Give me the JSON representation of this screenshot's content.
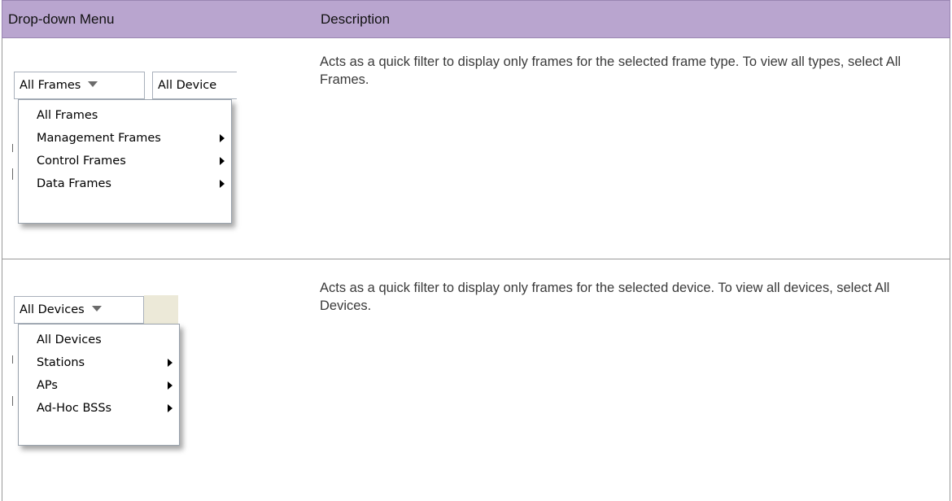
{
  "table": {
    "headers": [
      "Drop-down Menu",
      "Description"
    ],
    "rows": [
      {
        "description": "Acts as a quick filter to display only frames for the selected frame type. To view all types, select All Frames.",
        "widget": {
          "combo_label": "All Frames",
          "second_combo_label": "All Device",
          "menu_items": [
            {
              "label": "All Frames",
              "submenu": false
            },
            {
              "label": "Management Frames",
              "submenu": true
            },
            {
              "label": "Control Frames",
              "submenu": true
            },
            {
              "label": "Data Frames",
              "submenu": true
            }
          ]
        }
      },
      {
        "description": "Acts as a quick filter to display only frames for the selected device. To view all devices, select All Devices.",
        "widget": {
          "combo_label": "All Devices",
          "menu_items": [
            {
              "label": "All Devices",
              "submenu": false
            },
            {
              "label": "Stations",
              "submenu": true
            },
            {
              "label": "APs",
              "submenu": true
            },
            {
              "label": "Ad-Hoc BSSs",
              "submenu": true
            }
          ]
        }
      }
    ]
  },
  "colors": {
    "header_bg": "#b9a5cf",
    "border": "#999999"
  }
}
